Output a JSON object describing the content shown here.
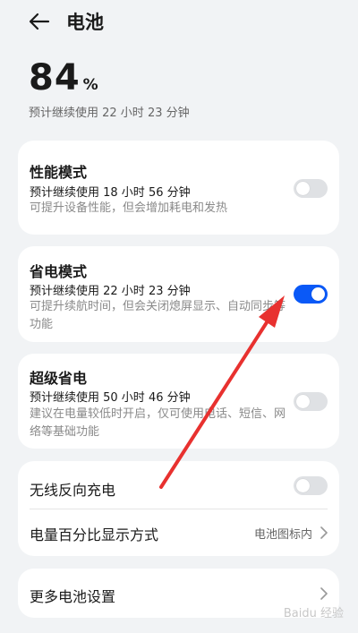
{
  "header": {
    "title": "电池",
    "back_icon": "back-arrow-icon"
  },
  "battery": {
    "percent": "84",
    "unit": "%",
    "estimate": "预计继续使用 22 小时 23 分钟"
  },
  "modes": [
    {
      "title": "性能模式",
      "estimate": "预计继续使用 18 小时 56 分钟",
      "desc": "可提升设备性能，但会增加耗电和发热",
      "enabled": false
    },
    {
      "title": "省电模式",
      "estimate": "预计继续使用 22 小时 23 分钟",
      "desc": "可提升续航时间，但会关闭熄屏显示、自动同步等功能",
      "enabled": true
    },
    {
      "title": "超级省电",
      "estimate": "预计继续使用 50 小时 46 分钟",
      "desc": "建议在电量较低时开启，仅可使用电话、短信、网络等基础功能",
      "enabled": false
    }
  ],
  "reverse_charge": {
    "title": "无线反向充电",
    "enabled": false
  },
  "percent_display": {
    "title": "电量百分比显示方式",
    "value": "电池图标内"
  },
  "more": {
    "title": "更多电池设置"
  },
  "colors": {
    "toggle_on": "#0a59f7",
    "toggle_off": "#dfe1e4",
    "annotation_arrow": "#e8312f"
  },
  "watermark": "Baidu 经验"
}
